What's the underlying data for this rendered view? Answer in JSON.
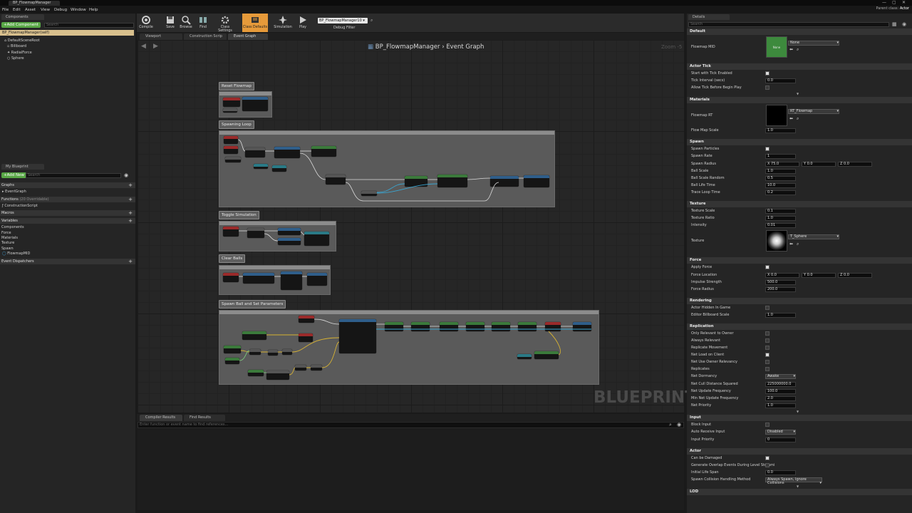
{
  "window": {
    "tab_title": "BP_FlowmapManager",
    "parent_class_label": "Parent class:",
    "parent_class_value": "Actor"
  },
  "menu": [
    "File",
    "Edit",
    "Asset",
    "View",
    "Debug",
    "Window",
    "Help"
  ],
  "left": {
    "components_tab": "Components",
    "add_component": "+Add Component",
    "search_placeholder": "Search",
    "self_item": "BP_FlowmapManager(self)",
    "tree": [
      "DefaultSceneRoot",
      "Billboard",
      "RadialForce",
      "Sphere"
    ],
    "my_blueprint_tab": "My Blueprint",
    "add_new": "+Add New",
    "graphs_header": "Graphs",
    "event_graph": "EventGraph",
    "functions_header": "Functions",
    "functions_overridable": "(20 Overridable)",
    "construction_script": "ConstructionScript",
    "macros_header": "Macros",
    "variables_header": "Variables",
    "var_categories": [
      "Components",
      "Force",
      "Materials",
      "Texture",
      "Spawn"
    ],
    "flowmap_var": "FlowmapMID",
    "dispatchers_header": "Event Dispatchers"
  },
  "toolbar": {
    "buttons": [
      "Compile",
      "Save",
      "Browse",
      "Find",
      "Class Settings",
      "Class Defaults",
      "Simulation",
      "Play"
    ],
    "debug_select": "BP_FlowmapManager10",
    "debug_filter": "Debug Filter"
  },
  "graph": {
    "tabs": [
      "Viewport",
      "Construction Scrip",
      "Event Graph"
    ],
    "title": "BP_FlowmapManager",
    "separator": "›",
    "subtitle": "Event Graph",
    "zoom": "Zoom -5",
    "watermark": "BLUEPRINT",
    "comments": [
      "Reset Flowmap",
      "Spawning Loop",
      "Toggle Simulation",
      "Clear Balls",
      "Spawn Ball and Set Parameters"
    ]
  },
  "bottom": {
    "tabs": [
      "Compiler Results",
      "Find Results"
    ],
    "search_placeholder": "Enter function or event name to find references..."
  },
  "details": {
    "tab": "Details",
    "search_placeholder": "Search",
    "sections": {
      "default": "Default",
      "actor_tick": "Actor Tick",
      "materials": "Materials",
      "spawn": "Spawn",
      "texture": "Texture",
      "force": "Force",
      "rendering": "Rendering",
      "replication": "Replication",
      "input": "Input",
      "actor": "Actor",
      "lod": "LOD"
    },
    "flowmap_mid": {
      "label": "Flowmap MID",
      "thumb": "None",
      "value": "None"
    },
    "tick": {
      "start_label": "Start with Tick Enabled",
      "interval_label": "Tick Interval (secs)",
      "interval": "0.0",
      "allow_label": "Allow Tick Before Begin Play"
    },
    "flowmap_rt": {
      "label": "Flowmap RT",
      "value": "RT_Flowmap"
    },
    "flow_map_scale": {
      "label": "Flow Map Scale",
      "value": "1.0"
    },
    "spawn_particles_label": "Spawn Particles",
    "spawn_rate": {
      "label": "Spawn Rate",
      "value": "1"
    },
    "spawn_radius": {
      "label": "Spawn Radius",
      "x": "X 75.0",
      "y": "Y 0.0",
      "z": "Z 0.0"
    },
    "ball_scale": {
      "label": "Ball Scale",
      "value": "1.0"
    },
    "ball_scale_random": {
      "label": "Ball Scale Random",
      "value": "0.5"
    },
    "ball_life_time": {
      "label": "Ball Life Time",
      "value": "10.0"
    },
    "trace_loop_time": {
      "label": "Trace Loop Time",
      "value": "0.2"
    },
    "texture_scale": {
      "label": "Texture Scale",
      "value": "0.1"
    },
    "texture_ratio": {
      "label": "Texture Ratio",
      "value": "1.0"
    },
    "intensity": {
      "label": "Intensity",
      "value": "0.01"
    },
    "texture": {
      "label": "Texture",
      "value": "T_Sphere"
    },
    "apply_force_label": "Apply Force",
    "force_location": {
      "label": "Force Location",
      "x": "X 0.0",
      "y": "Y 0.0",
      "z": "Z 0.0"
    },
    "impulse_strength": {
      "label": "Impulse Strength",
      "value": "500.0"
    },
    "force_radius": {
      "label": "Force Radius",
      "value": "200.0"
    },
    "actor_hidden_label": "Actor Hidden In Game",
    "editor_billboard": {
      "label": "Editor Billboard Scale",
      "value": "1.0"
    },
    "replication": {
      "only_relevant": "Only Relevant to Owner",
      "always_relevant": "Always Relevant",
      "replicate_movement": "Replicate Movement",
      "net_load_on_client": "Net Load on Client",
      "net_use_owner": "Net Use Owner Relevancy",
      "replicates": "Replicates",
      "net_dormancy_label": "Net Dormancy",
      "net_dormancy": "Awake",
      "cull_label": "Net Cull Distance Squared",
      "cull": "225000000.0",
      "update_freq_label": "Net Update Frequency",
      "update_freq": "100.0",
      "min_update_label": "Min Net Update Frequency",
      "min_update": "2.0",
      "priority_label": "Net Priority",
      "priority": "1.0"
    },
    "input": {
      "block_label": "Block Input",
      "auto_receive_label": "Auto Receive Input",
      "auto_receive": "Disabled",
      "priority_label": "Input Priority",
      "priority": "0"
    },
    "actor": {
      "can_be_damaged": "Can be Damaged",
      "generate_overlap": "Generate Overlap Events During Level Streami",
      "life_span_label": "Initial Life Span",
      "life_span": "0.0",
      "collision_label": "Spawn Collision Handling Method",
      "collision": "Always Spawn, Ignore Collisions"
    }
  }
}
